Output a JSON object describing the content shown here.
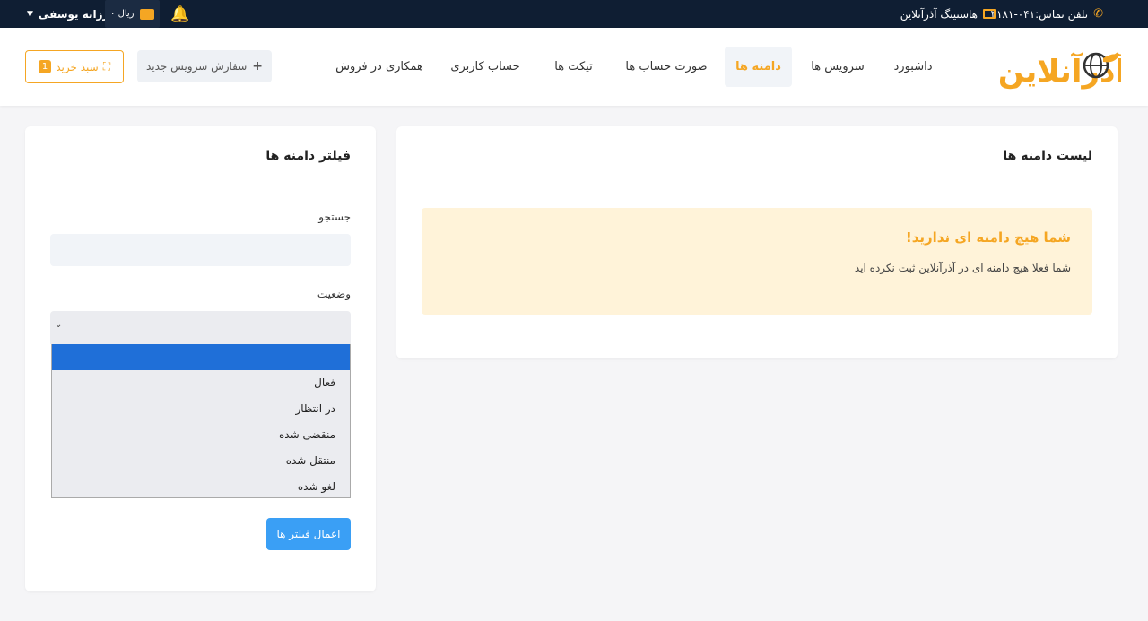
{
  "topbar": {
    "phone": "تلفن تماس:۰۴۱-۴۱۸۱",
    "hosting": "هاستینگ آذرآنلاین",
    "user": "فرزانه یوسفی",
    "wallet": "۰ ریال"
  },
  "header": {
    "logo_text": "آذرآنلاین",
    "nav": [
      "داشبورد",
      "سرویس ها",
      "دامنه ها",
      "صورت حساب ها",
      "تیکت ها",
      "حساب کاربری",
      "همکاری در فروش"
    ],
    "active_nav": "دامنه ها",
    "order_button": "سفارش سرویس جدید",
    "cart_button": "سبد خرید",
    "cart_count": "1"
  },
  "main": {
    "title": "لیست دامنه ها",
    "alert_title": "شما هیچ دامنه ای ندارید!",
    "alert_text": "شما فعلا هیچ دامنه ای در آذرآنلاین ثبت نکرده اید"
  },
  "filter": {
    "title": "فیلتر دامنه ها",
    "search_label": "جستجو",
    "search_value": "",
    "status_label": "وضعیت",
    "status_selected": "",
    "options": [
      "",
      "فعال",
      "در انتظار",
      "منقضی شده",
      "منتقل شده",
      "لغو شده"
    ],
    "apply_button": "اعمال فیلتر ها"
  },
  "colors": {
    "accent": "#f5a623",
    "topbar": "#0f1e33",
    "primary": "#3a9ff5",
    "selected_option": "#1f6fd8"
  }
}
